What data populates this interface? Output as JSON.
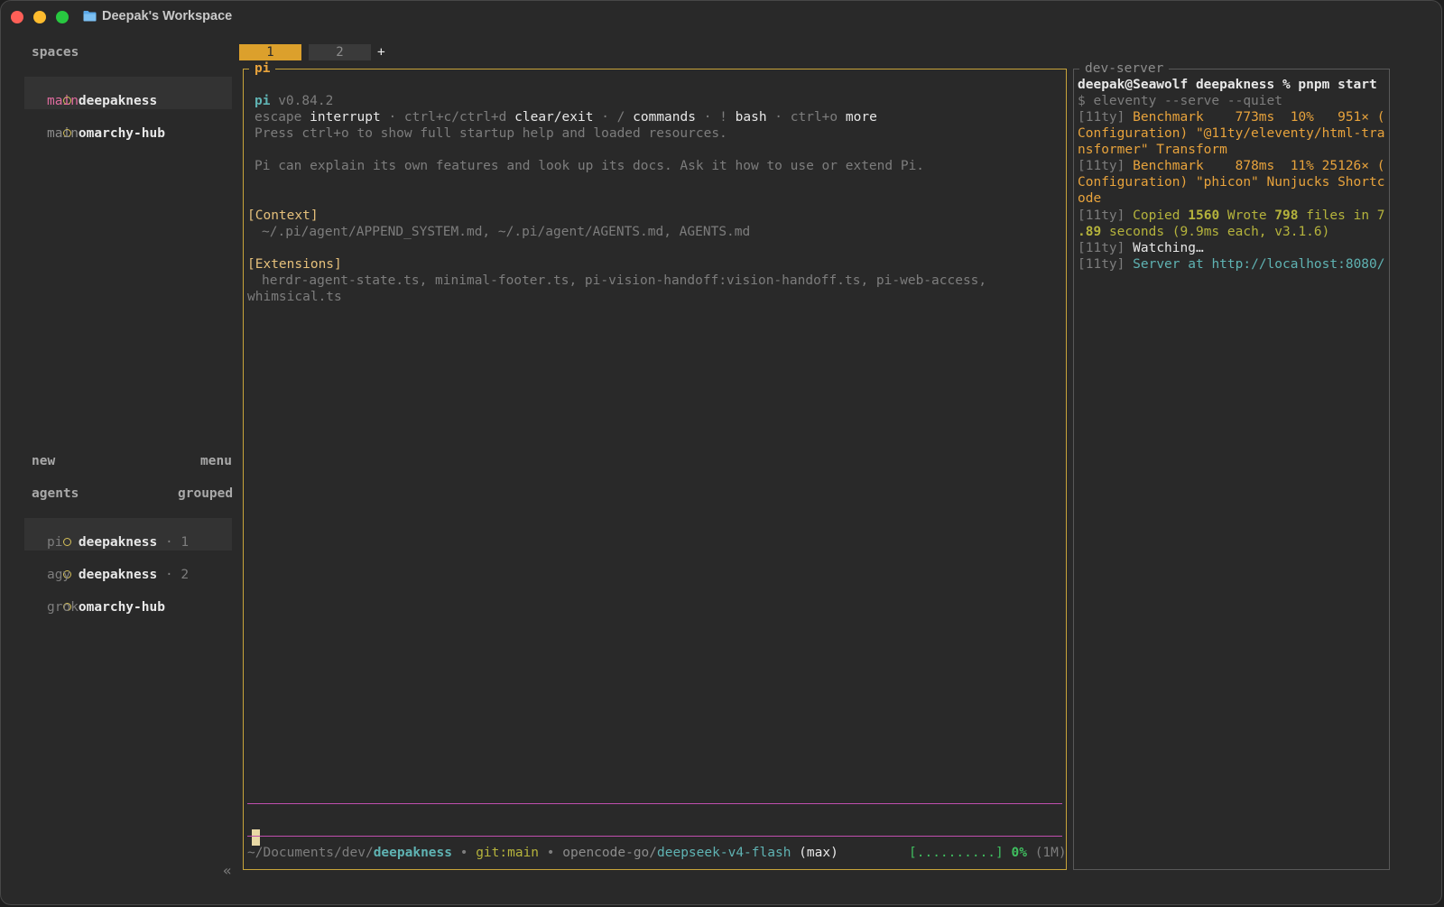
{
  "window": {
    "title": "Deepak's Workspace"
  },
  "sidebar": {
    "spaces_header": "spaces",
    "spaces": [
      {
        "name": "deepakness",
        "branch": "main"
      },
      {
        "name": "omarchy-hub",
        "branch": "main"
      }
    ],
    "new_label": "new",
    "menu_label": "menu",
    "agents_header": "agents",
    "grouped_label": "grouped",
    "agents": [
      {
        "name": "deepakness",
        "num": "· 1",
        "sub": "pi"
      },
      {
        "name": "deepakness",
        "num": "· 2",
        "sub": "agy"
      },
      {
        "name": "omarchy-hub",
        "num": "",
        "sub": "grok"
      }
    ],
    "collapse": "«"
  },
  "tabs": {
    "items": [
      "1",
      "2"
    ],
    "add": "+"
  },
  "main_pane": {
    "label": "pi",
    "header_name": "pi",
    "version": "v0.84.2",
    "help1": {
      "k1": "escape",
      "a1": "interrupt",
      "sep1": "·",
      "k2": "ctrl+c/ctrl+d",
      "a2": "clear/exit",
      "sep2": "·",
      "k3": "/",
      "a3": "commands",
      "sep3": "·",
      "k4": "!",
      "a4": "bash",
      "sep4": "·",
      "k5": "ctrl+o",
      "a5": "more"
    },
    "help2": "Press ctrl+o to show full startup help and loaded resources.",
    "explain": "Pi can explain its own features and look up its docs. Ask it how to use or extend Pi.",
    "context_header": "[Context]",
    "context_files": "~/.pi/agent/APPEND_SYSTEM.md, ~/.pi/agent/AGENTS.md, AGENTS.md",
    "extensions_header": "[Extensions]",
    "extensions_line1": "herdr-agent-state.ts, minimal-footer.ts, pi-vision-handoff:vision-handoff.ts, pi-web-access,",
    "extensions_line2": "whimsical.ts",
    "status": {
      "path_prefix": "~/Documents/dev/",
      "path_dir": "deepakness",
      "dot1": "•",
      "git": "git:main",
      "dot2": "•",
      "model_prefix": "opencode-go/",
      "model": "deepseek-v4-flash",
      "mode": "(max)",
      "progress_bar": "[..........]",
      "percent": "0%",
      "context_size": "(1M)"
    }
  },
  "dev_pane": {
    "label": "dev-server",
    "prompt": "deepak@Seawolf deepakness % pnpm start",
    "cmd": "$ eleventy --serve --quiet",
    "b1_tag": "[11ty]",
    "b1_l1": "Benchmark    773ms  10%   951× (",
    "b1_l2": "Configuration) \"@11ty/eleventy/html-tra",
    "b1_l3": "nsformer\" Transform",
    "b2_tag": "[11ty]",
    "b2_l1": "Benchmark    878ms  11% 25126× (",
    "b2_l2": "Configuration) \"phicon\" Nunjucks Shortc",
    "b2_l3": "ode",
    "c_tag": "[11ty]",
    "c_copied": "Copied",
    "c_n1": "1560",
    "c_wrote": "Wrote",
    "c_n2": "798",
    "c_rest1": "files in 7",
    "c_rest2a": ".89",
    "c_rest2b": "seconds (9.9ms each, v3.1.6)",
    "w_tag": "[11ty]",
    "watching": "Watching…",
    "s_tag": "[11ty]",
    "server_text": "Server at",
    "server_url": "http://localhost:8080/"
  },
  "colors": {
    "accent": "#dca02c",
    "pane_border": "#c8a43a",
    "input_border": "#c04fae",
    "background": "#292929"
  }
}
